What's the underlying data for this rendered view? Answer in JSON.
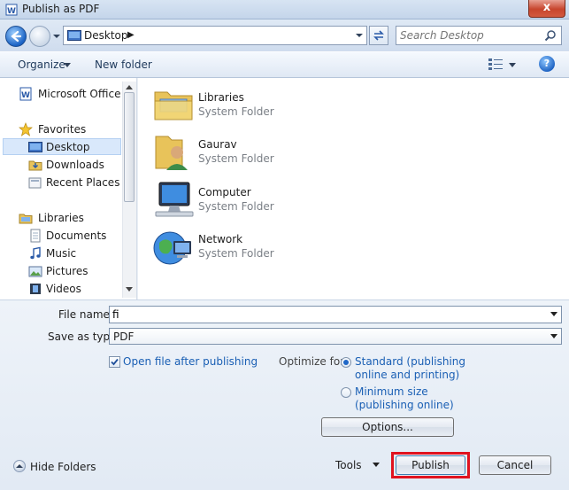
{
  "window": {
    "title": "Publish as PDF",
    "close_label": "x"
  },
  "address": {
    "path": "Desktop",
    "separator": "▶"
  },
  "search": {
    "placeholder": "Search Desktop"
  },
  "toolbar": {
    "organize": "Organize",
    "new_folder": "New folder"
  },
  "nav": {
    "recent_doc": "Microsoft Office W",
    "favorites": "Favorites",
    "favorites_items": [
      "Desktop",
      "Downloads",
      "Recent Places"
    ],
    "libraries": "Libraries",
    "libraries_items": [
      "Documents",
      "Music",
      "Pictures",
      "Videos"
    ],
    "selected": "Desktop"
  },
  "files": [
    {
      "name": "Libraries",
      "type": "System Folder",
      "icon": "libraries-folder-icon"
    },
    {
      "name": "Gaurav",
      "type": "System Folder",
      "icon": "user-folder-icon"
    },
    {
      "name": "Computer",
      "type": "System Folder",
      "icon": "computer-icon"
    },
    {
      "name": "Network",
      "type": "System Folder",
      "icon": "network-icon"
    }
  ],
  "form": {
    "file_name_label": "File name:",
    "file_name_value": "fi",
    "save_type_label": "Save as type:",
    "save_type_value": "PDF",
    "open_after_label": "Open file after publishing",
    "open_after_checked": true,
    "optimize_label": "Optimize for:",
    "optimize_standard_line1": "Standard (publishing",
    "optimize_standard_line2": "online and printing)",
    "optimize_min_line1": "Minimum size",
    "optimize_min_line2": "(publishing online)",
    "optimize_selected": "standard",
    "options_button": "Options..."
  },
  "footer": {
    "hide_folders": "Hide Folders",
    "tools": "Tools",
    "publish": "Publish",
    "cancel": "Cancel"
  },
  "colors": {
    "highlight": "#e0131f",
    "link": "#1a5fb4"
  }
}
